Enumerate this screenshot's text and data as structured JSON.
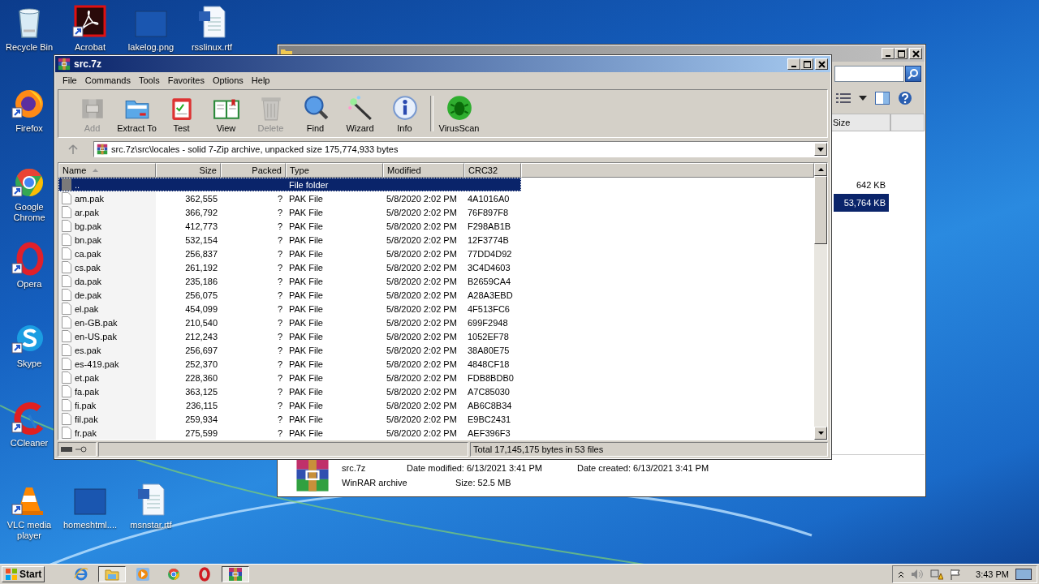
{
  "desktop_icons": [
    {
      "label": "Recycle Bin",
      "kind": "recycle",
      "shortcut": false
    },
    {
      "label": "Acrobat",
      "kind": "acrobat",
      "shortcut": true
    },
    {
      "label": "lakelog.png",
      "kind": "blank",
      "shortcut": false
    },
    {
      "label": "rsslinux.rtf",
      "kind": "word",
      "shortcut": false
    },
    {
      "label": "Firefox",
      "kind": "firefox",
      "shortcut": true
    },
    {
      "label": "Google Chrome",
      "kind": "chrome",
      "shortcut": true
    },
    {
      "label": "Opera",
      "kind": "opera",
      "shortcut": true
    },
    {
      "label": "Skype",
      "kind": "skype",
      "shortcut": true
    },
    {
      "label": "CCleaner",
      "kind": "ccleaner",
      "shortcut": true
    },
    {
      "label": "VLC media player",
      "kind": "vlc",
      "shortcut": true
    },
    {
      "label": "homeshtml....",
      "kind": "blank",
      "shortcut": false
    },
    {
      "label": "msnstar.rtf",
      "kind": "word",
      "shortcut": false
    }
  ],
  "explorer_window": {
    "size_header": "Size",
    "sizes": [
      {
        "text": "642 KB",
        "selected": false
      },
      {
        "text": "53,764 KB",
        "selected": true
      }
    ],
    "details": {
      "name": "src.7z",
      "type": "WinRAR archive",
      "date_modified": "Date modified: 6/13/2021 3:41 PM",
      "date_created": "Date created: 6/13/2021 3:41 PM",
      "size": "Size: 52.5 MB"
    }
  },
  "winrar": {
    "title": "src.7z",
    "menu": [
      "File",
      "Commands",
      "Tools",
      "Favorites",
      "Options",
      "Help"
    ],
    "toolbar": [
      {
        "label": "Add",
        "kind": "add",
        "disabled": true
      },
      {
        "label": "Extract To",
        "kind": "extract",
        "disabled": false
      },
      {
        "label": "Test",
        "kind": "test",
        "disabled": false
      },
      {
        "label": "View",
        "kind": "view",
        "disabled": false
      },
      {
        "label": "Delete",
        "kind": "delete",
        "disabled": true
      },
      {
        "label": "Find",
        "kind": "find",
        "disabled": false
      },
      {
        "label": "Wizard",
        "kind": "wizard",
        "disabled": false
      },
      {
        "label": "Info",
        "kind": "info",
        "disabled": false
      },
      {
        "label": "VirusScan",
        "kind": "virusscan",
        "disabled": false
      }
    ],
    "path": "src.7z\\src\\locales - solid 7-Zip archive, unpacked size 175,774,933 bytes",
    "columns": [
      {
        "label": "Name",
        "sorted": true
      },
      {
        "label": "Size",
        "sorted": false
      },
      {
        "label": "Packed",
        "sorted": false
      },
      {
        "label": "Type",
        "sorted": false
      },
      {
        "label": "Modified",
        "sorted": false
      },
      {
        "label": "CRC32",
        "sorted": false
      }
    ],
    "rows": [
      {
        "name": "..",
        "type": "File folder",
        "kind": "folder",
        "selected": true
      },
      {
        "name": "am.pak",
        "size": "362,555",
        "packed": "?",
        "type": "PAK File",
        "modified": "5/8/2020 2:02 PM",
        "crc32": "4A1016A0",
        "kind": "file",
        "selected": false
      },
      {
        "name": "ar.pak",
        "size": "366,792",
        "packed": "?",
        "type": "PAK File",
        "modified": "5/8/2020 2:02 PM",
        "crc32": "76F897F8",
        "kind": "file",
        "selected": false
      },
      {
        "name": "bg.pak",
        "size": "412,773",
        "packed": "?",
        "type": "PAK File",
        "modified": "5/8/2020 2:02 PM",
        "crc32": "F298AB1B",
        "kind": "file",
        "selected": false
      },
      {
        "name": "bn.pak",
        "size": "532,154",
        "packed": "?",
        "type": "PAK File",
        "modified": "5/8/2020 2:02 PM",
        "crc32": "12F3774B",
        "kind": "file",
        "selected": false
      },
      {
        "name": "ca.pak",
        "size": "256,837",
        "packed": "?",
        "type": "PAK File",
        "modified": "5/8/2020 2:02 PM",
        "crc32": "77DD4D92",
        "kind": "file",
        "selected": false
      },
      {
        "name": "cs.pak",
        "size": "261,192",
        "packed": "?",
        "type": "PAK File",
        "modified": "5/8/2020 2:02 PM",
        "crc32": "3C4D4603",
        "kind": "file",
        "selected": false
      },
      {
        "name": "da.pak",
        "size": "235,186",
        "packed": "?",
        "type": "PAK File",
        "modified": "5/8/2020 2:02 PM",
        "crc32": "B2659CA4",
        "kind": "file",
        "selected": false
      },
      {
        "name": "de.pak",
        "size": "256,075",
        "packed": "?",
        "type": "PAK File",
        "modified": "5/8/2020 2:02 PM",
        "crc32": "A28A3EBD",
        "kind": "file",
        "selected": false
      },
      {
        "name": "el.pak",
        "size": "454,099",
        "packed": "?",
        "type": "PAK File",
        "modified": "5/8/2020 2:02 PM",
        "crc32": "4F513FC6",
        "kind": "file",
        "selected": false
      },
      {
        "name": "en-GB.pak",
        "size": "210,540",
        "packed": "?",
        "type": "PAK File",
        "modified": "5/8/2020 2:02 PM",
        "crc32": "699F2948",
        "kind": "file",
        "selected": false
      },
      {
        "name": "en-US.pak",
        "size": "212,243",
        "packed": "?",
        "type": "PAK File",
        "modified": "5/8/2020 2:02 PM",
        "crc32": "1052EF78",
        "kind": "file",
        "selected": false
      },
      {
        "name": "es.pak",
        "size": "256,697",
        "packed": "?",
        "type": "PAK File",
        "modified": "5/8/2020 2:02 PM",
        "crc32": "38A80E75",
        "kind": "file",
        "selected": false
      },
      {
        "name": "es-419.pak",
        "size": "252,370",
        "packed": "?",
        "type": "PAK File",
        "modified": "5/8/2020 2:02 PM",
        "crc32": "4848CF18",
        "kind": "file",
        "selected": false
      },
      {
        "name": "et.pak",
        "size": "228,360",
        "packed": "?",
        "type": "PAK File",
        "modified": "5/8/2020 2:02 PM",
        "crc32": "FDB8BDB0",
        "kind": "file",
        "selected": false
      },
      {
        "name": "fa.pak",
        "size": "363,125",
        "packed": "?",
        "type": "PAK File",
        "modified": "5/8/2020 2:02 PM",
        "crc32": "A7C85030",
        "kind": "file",
        "selected": false
      },
      {
        "name": "fi.pak",
        "size": "236,115",
        "packed": "?",
        "type": "PAK File",
        "modified": "5/8/2020 2:02 PM",
        "crc32": "AB6C8B34",
        "kind": "file",
        "selected": false
      },
      {
        "name": "fil.pak",
        "size": "259,934",
        "packed": "?",
        "type": "PAK File",
        "modified": "5/8/2020 2:02 PM",
        "crc32": "E9BC2431",
        "kind": "file",
        "selected": false
      },
      {
        "name": "fr.pak",
        "size": "275,599",
        "packed": "?",
        "type": "PAK File",
        "modified": "5/8/2020 2:02 PM",
        "crc32": "AEF396F3",
        "kind": "file",
        "selected": false
      }
    ],
    "status": "Total 17,145,175 bytes in 53 files"
  },
  "taskbar": {
    "start": "Start",
    "apps": [
      {
        "kind": "ie",
        "selected": false
      },
      {
        "kind": "explorer",
        "selected": true
      },
      {
        "kind": "media",
        "selected": false
      },
      {
        "kind": "chrome",
        "selected": false
      },
      {
        "kind": "opera",
        "selected": false
      },
      {
        "kind": "winrar",
        "selected": true
      }
    ],
    "clock": "3:43 PM"
  }
}
